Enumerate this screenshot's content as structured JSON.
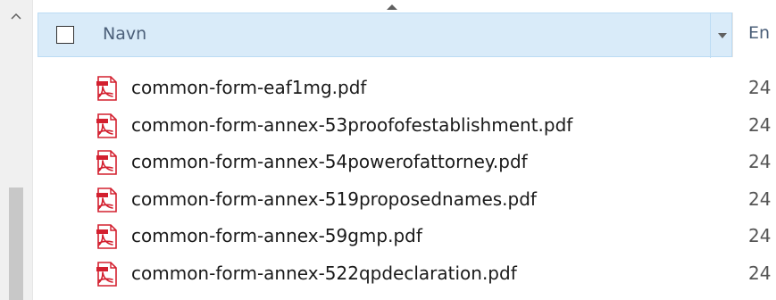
{
  "header": {
    "name_label": "Navn",
    "next_column_label": "En"
  },
  "files": [
    {
      "name": "common-form-eaf1mg.pdf",
      "date": "24",
      "icon": "pdf-file-icon"
    },
    {
      "name": "common-form-annex-53proofofestablishment.pdf",
      "date": "24",
      "icon": "pdf-file-icon"
    },
    {
      "name": "common-form-annex-54powerofattorney.pdf",
      "date": "24",
      "icon": "pdf-file-icon"
    },
    {
      "name": "common-form-annex-519proposednames.pdf",
      "date": "24",
      "icon": "pdf-file-icon"
    },
    {
      "name": "common-form-annex-59gmp.pdf",
      "date": "24",
      "icon": "pdf-file-icon"
    },
    {
      "name": "common-form-annex-522qpdeclaration.pdf",
      "date": "24",
      "icon": "pdf-file-icon"
    }
  ],
  "colors": {
    "header_bg": "#d9ebf9",
    "header_border": "#bcdcf4",
    "pdf_red": "#d3202f"
  }
}
